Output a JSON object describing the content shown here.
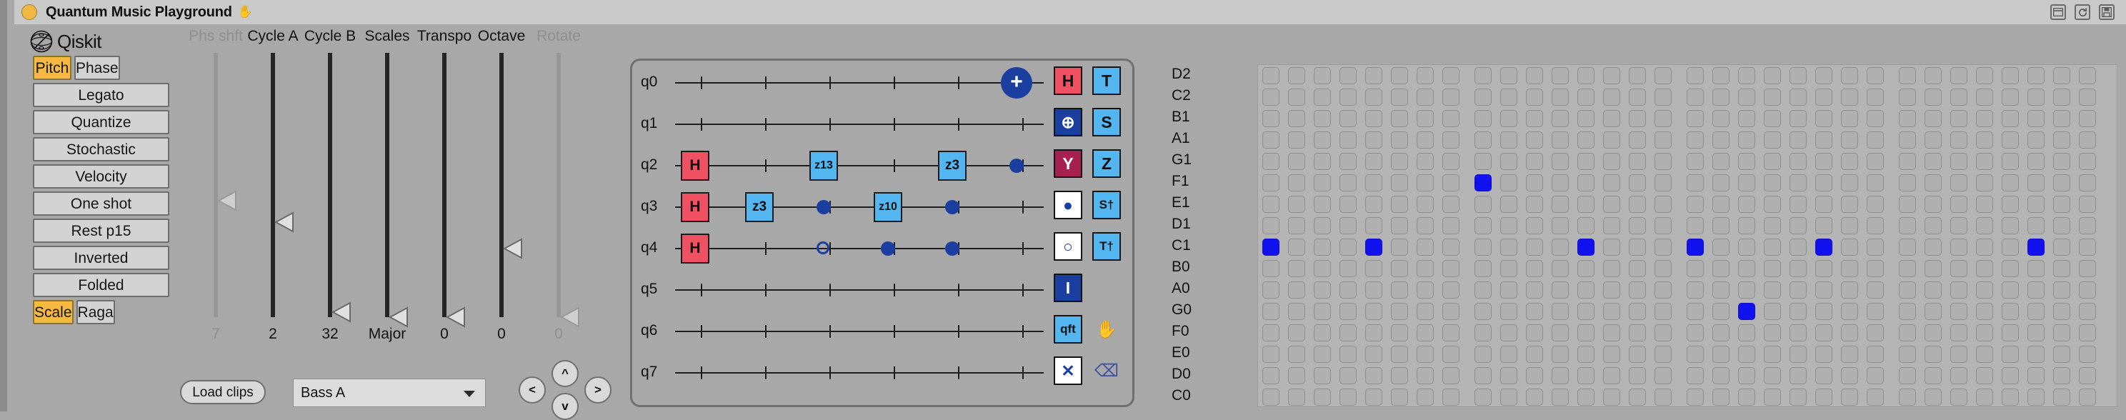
{
  "window": {
    "title": "Quantum Music Playground",
    "title_hand_icon": "hand-icon",
    "buttons": [
      "window-restore-icon",
      "reload-icon",
      "save-icon"
    ]
  },
  "brand": {
    "name": "Qiskit",
    "logo": "qiskit-logo-icon"
  },
  "left_panel": {
    "mode_buttons": [
      {
        "label": "Pitch",
        "active": true
      },
      {
        "label": "Phase",
        "active": false
      }
    ],
    "buttons": [
      {
        "label": "Legato",
        "active": false
      },
      {
        "label": "Quantize",
        "active": false
      },
      {
        "label": "Stochastic",
        "active": false
      },
      {
        "label": "Velocity",
        "active": false
      },
      {
        "label": "One shot",
        "active": false
      },
      {
        "label": "Rest p15",
        "active": false
      },
      {
        "label": "Inverted",
        "active": false
      },
      {
        "label": "Folded",
        "active": false
      }
    ],
    "scale_buttons": [
      {
        "label": "Scale",
        "active": true
      },
      {
        "label": "Raga",
        "active": false
      }
    ]
  },
  "sliders": [
    {
      "label": "Phs shft",
      "value": "7",
      "disabled": true,
      "handle_pct": 0.56
    },
    {
      "label": "Cycle A",
      "value": "2",
      "disabled": false,
      "handle_pct": 0.64
    },
    {
      "label": "Cycle B",
      "value": "32",
      "disabled": false,
      "handle_pct": 0.98
    },
    {
      "label": "Scales",
      "value": "Major",
      "disabled": false,
      "handle_pct": 1.0
    },
    {
      "label": "Transpo",
      "value": "0",
      "disabled": false,
      "handle_pct": 1.0
    },
    {
      "label": "Octave",
      "value": "0",
      "disabled": false,
      "handle_pct": 0.74
    },
    {
      "label": "Rotate",
      "value": "0",
      "disabled": true,
      "handle_pct": 1.0
    }
  ],
  "transport": {
    "load_clips_label": "Load clips",
    "clip_select_value": "Bass A",
    "dpad": {
      "up": "^",
      "down": "v",
      "left": "<",
      "right": ">"
    }
  },
  "circuit": {
    "qubits": [
      "q0",
      "q1",
      "q2",
      "q3",
      "q4",
      "q5",
      "q6",
      "q7"
    ],
    "gates": [
      {
        "qubit": 0,
        "col": 5,
        "type": "target",
        "label": "+"
      },
      {
        "qubit": 2,
        "col": 0,
        "type": "h",
        "label": "H"
      },
      {
        "qubit": 2,
        "col": 2,
        "type": "phase",
        "label": "z13"
      },
      {
        "qubit": 2,
        "col": 4,
        "type": "phase",
        "label": "z3"
      },
      {
        "qubit": 2,
        "col": 5,
        "type": "ctrl-dot",
        "label": ""
      },
      {
        "qubit": 3,
        "col": 0,
        "type": "h",
        "label": "H"
      },
      {
        "qubit": 3,
        "col": 1,
        "type": "phase",
        "label": "z3"
      },
      {
        "qubit": 3,
        "col": 2,
        "type": "ctrl-dot",
        "label": ""
      },
      {
        "qubit": 3,
        "col": 3,
        "type": "phase",
        "label": "z10"
      },
      {
        "qubit": 3,
        "col": 4,
        "type": "ctrl-dot",
        "label": ""
      },
      {
        "qubit": 4,
        "col": 0,
        "type": "h",
        "label": "H"
      },
      {
        "qubit": 4,
        "col": 2,
        "type": "ctrl-open",
        "label": ""
      },
      {
        "qubit": 4,
        "col": 3,
        "type": "ctrl-dot",
        "label": ""
      },
      {
        "qubit": 4,
        "col": 4,
        "type": "ctrl-dot",
        "label": ""
      }
    ],
    "palette": [
      {
        "label": "H",
        "style": "red",
        "name": "gate-h"
      },
      {
        "label": "T",
        "style": "lblue",
        "name": "gate-t"
      },
      {
        "label": "⊕",
        "style": "dblue",
        "name": "gate-not"
      },
      {
        "label": "S",
        "style": "lblue",
        "name": "gate-s"
      },
      {
        "label": "Y",
        "style": "mar",
        "name": "gate-y"
      },
      {
        "label": "Z",
        "style": "lblue",
        "name": "gate-z"
      },
      {
        "label": "●",
        "style": "white",
        "name": "gate-control"
      },
      {
        "label": "S†",
        "style": "lblue",
        "name": "gate-sdg"
      },
      {
        "label": "○",
        "style": "white",
        "name": "gate-anticontrol"
      },
      {
        "label": "T†",
        "style": "lblue",
        "name": "gate-tdg"
      },
      {
        "label": "I",
        "style": "dblue",
        "name": "gate-identity"
      },
      {
        "label": "qft",
        "style": "lblue",
        "name": "gate-qft"
      },
      {
        "label": "✕",
        "style": "white",
        "name": "gate-swap"
      }
    ],
    "tools": [
      {
        "label": "✋",
        "name": "hand-tool-icon"
      },
      {
        "label": "⌫",
        "name": "erase-tool-icon"
      }
    ]
  },
  "piano_roll": {
    "note_names": [
      "D2",
      "C2",
      "B1",
      "A1",
      "G1",
      "F1",
      "E1",
      "D1",
      "C1",
      "B0",
      "A0",
      "G0",
      "F0",
      "E0",
      "D0",
      "C0"
    ],
    "columns": 32,
    "active_cells": [
      {
        "row": 5,
        "col": 8
      },
      {
        "row": 8,
        "col": 0
      },
      {
        "row": 8,
        "col": 4
      },
      {
        "row": 8,
        "col": 12
      },
      {
        "row": 8,
        "col": 16
      },
      {
        "row": 8,
        "col": 21
      },
      {
        "row": 8,
        "col": 29
      },
      {
        "row": 11,
        "col": 18
      }
    ]
  },
  "colors": {
    "accent": "#f5b942",
    "gate_h": "#ef5163",
    "gate_phase": "#54b6f0",
    "gate_control": "#1b3fa0",
    "note_on": "#1111ee",
    "panel_bg": "#a8a8a8"
  }
}
